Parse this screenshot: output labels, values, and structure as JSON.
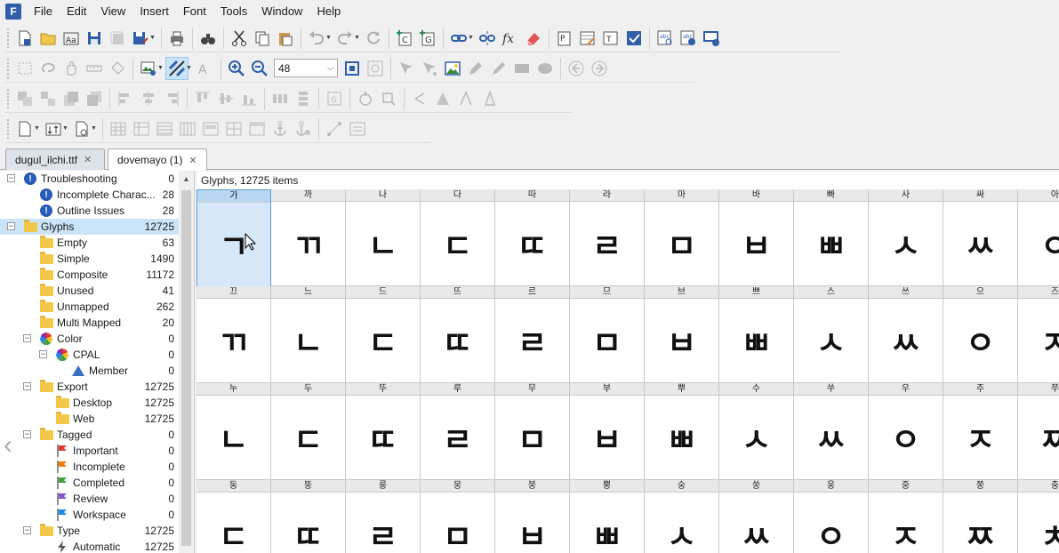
{
  "app": {
    "icon_letter": "F"
  },
  "menu": [
    "File",
    "Edit",
    "View",
    "Insert",
    "Font",
    "Tools",
    "Window",
    "Help"
  ],
  "toolbar": {
    "zoom_value": "48"
  },
  "tabs": [
    {
      "label": "dugul_ilchi.ttf",
      "active": false
    },
    {
      "label": "dovemayo (1)",
      "active": true
    }
  ],
  "sidebar": {
    "items": [
      {
        "label": "Troubleshooting",
        "count": "0",
        "icon": "info-icon",
        "level": 0,
        "expander": "minus"
      },
      {
        "label": "Incomplete Charac...",
        "count": "28",
        "icon": "info-icon",
        "level": 1
      },
      {
        "label": "Outline Issues",
        "count": "28",
        "icon": "info-icon",
        "level": 1
      },
      {
        "label": "Glyphs",
        "count": "12725",
        "icon": "folder-icon",
        "level": 0,
        "expander": "minus",
        "selected": true
      },
      {
        "label": "Empty",
        "count": "63",
        "icon": "folder-icon",
        "level": 1
      },
      {
        "label": "Simple",
        "count": "1490",
        "icon": "folder-icon",
        "level": 1
      },
      {
        "label": "Composite",
        "count": "11172",
        "icon": "folder-icon",
        "level": 1
      },
      {
        "label": "Unused",
        "count": "41",
        "icon": "folder-icon",
        "level": 1
      },
      {
        "label": "Unmapped",
        "count": "262",
        "icon": "folder-icon",
        "level": 1
      },
      {
        "label": "Multi Mapped",
        "count": "20",
        "icon": "folder-icon",
        "level": 1
      },
      {
        "label": "Color",
        "count": "0",
        "icon": "color-wheel-icon",
        "level": 1,
        "expander": "minus"
      },
      {
        "label": "CPAL",
        "count": "0",
        "icon": "color-wheel-icon",
        "level": 2,
        "expander": "minus"
      },
      {
        "label": "Member",
        "count": "0",
        "icon": "triangle-icon",
        "level": 3
      },
      {
        "label": "Export",
        "count": "12725",
        "icon": "folder-icon",
        "level": 1,
        "expander": "minus"
      },
      {
        "label": "Desktop",
        "count": "12725",
        "icon": "folder-icon",
        "level": 2
      },
      {
        "label": "Web",
        "count": "12725",
        "icon": "folder-icon",
        "level": 2
      },
      {
        "label": "Tagged",
        "count": "0",
        "icon": "folder-icon",
        "level": 1,
        "expander": "minus"
      },
      {
        "label": "Important",
        "count": "0",
        "icon": "flag-icon",
        "level": 2,
        "flag_color": "#e53935"
      },
      {
        "label": "Incomplete",
        "count": "0",
        "icon": "flag-icon",
        "level": 2,
        "flag_color": "#f57c00"
      },
      {
        "label": "Completed",
        "count": "0",
        "icon": "flag-icon",
        "level": 2,
        "flag_color": "#43a047"
      },
      {
        "label": "Review",
        "count": "0",
        "icon": "flag-icon",
        "level": 2,
        "flag_color": "#7e57c2"
      },
      {
        "label": "Workspace",
        "count": "0",
        "icon": "flag-icon",
        "level": 2,
        "flag_color": "#1e88e5"
      },
      {
        "label": "Type",
        "count": "12725",
        "icon": "folder-icon",
        "level": 1,
        "expander": "minus"
      },
      {
        "label": "Automatic",
        "count": "12725",
        "icon": "lightning-icon",
        "level": 2
      }
    ]
  },
  "glyph_panel": {
    "title": "Glyphs, 12725 items",
    "rows": [
      {
        "names": [
          "가",
          "까",
          "나",
          "다",
          "따",
          "라",
          "마",
          "바",
          "빠",
          "사",
          "싸",
          "아"
        ],
        "glyphs": [
          "ㄱ",
          "ㄲ",
          "ㄴ",
          "ㄷ",
          "ㄸ",
          "ㄹ",
          "ㅁ",
          "ㅂ",
          "ㅃ",
          "ㅅ",
          "ㅆ",
          "ㅇ"
        ]
      },
      {
        "names": [
          "끄",
          "느",
          "드",
          "뜨",
          "르",
          "므",
          "브",
          "쁘",
          "스",
          "쓰",
          "으",
          "즈"
        ],
        "glyphs": [
          "ㄲ",
          "ㄴ",
          "ㄷ",
          "ㄸ",
          "ㄹ",
          "ㅁ",
          "ㅂ",
          "ㅃ",
          "ㅅ",
          "ㅆ",
          "ㅇ",
          "ㅈ"
        ]
      },
      {
        "names": [
          "누",
          "두",
          "뚜",
          "루",
          "무",
          "부",
          "뿌",
          "수",
          "쑤",
          "우",
          "주",
          "쭈"
        ],
        "glyphs": [
          "ㄴ",
          "ㄷ",
          "ㄸ",
          "ㄹ",
          "ㅁ",
          "ㅂ",
          "ㅃ",
          "ㅅ",
          "ㅆ",
          "ㅇ",
          "ㅈ",
          "ㅉ"
        ]
      },
      {
        "names": [
          "둥",
          "뚱",
          "룽",
          "뭉",
          "붕",
          "뿡",
          "숭",
          "쑹",
          "웅",
          "중",
          "쭝",
          "충"
        ],
        "glyphs": [
          "ㄷ",
          "ㄸ",
          "ㄹ",
          "ㅁ",
          "ㅂ",
          "ㅃ",
          "ㅅ",
          "ㅆ",
          "ㅇ",
          "ㅈ",
          "ㅉ",
          "ㅊ"
        ]
      }
    ]
  }
}
